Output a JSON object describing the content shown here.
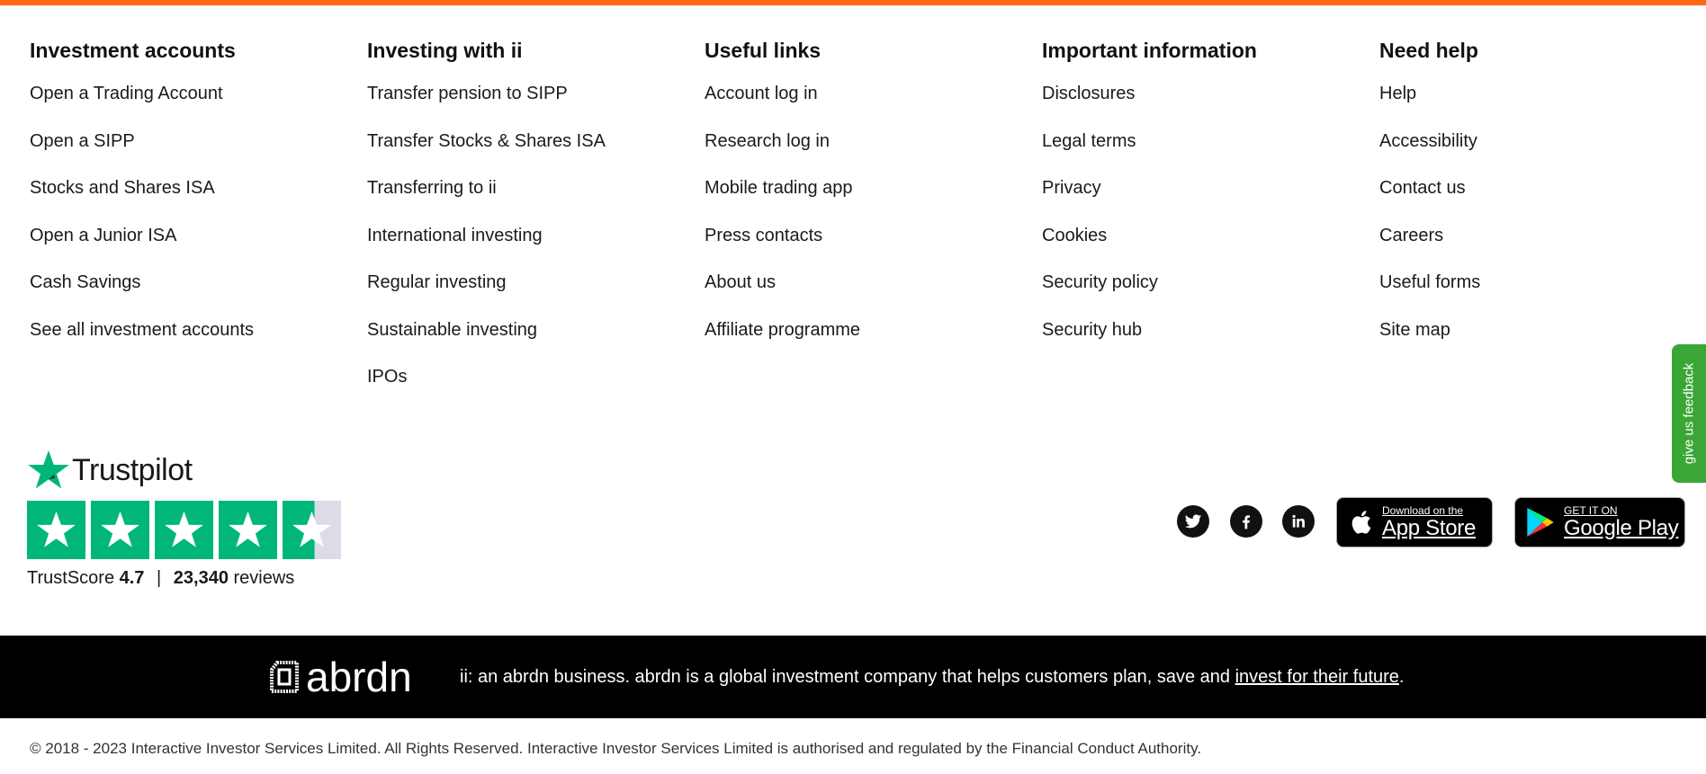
{
  "colors": {
    "accent": "#ff6a13",
    "trustpilot_green": "#00b67a",
    "feedback_green": "#3aa635",
    "band": "#000000"
  },
  "columns": [
    {
      "heading": "Investment accounts",
      "links": [
        "Open a Trading Account",
        "Open a SIPP",
        "Stocks and Shares ISA",
        "Open a Junior ISA",
        "Cash Savings",
        "See all investment accounts"
      ]
    },
    {
      "heading": "Investing with ii",
      "links": [
        "Transfer pension to SIPP",
        "Transfer Stocks & Shares ISA",
        "Transferring to ii",
        "International investing",
        "Regular investing",
        "Sustainable investing",
        "IPOs"
      ]
    },
    {
      "heading": "Useful links",
      "links": [
        "Account log in",
        "Research log in",
        "Mobile trading app",
        "Press contacts",
        "About us",
        "Affiliate programme"
      ]
    },
    {
      "heading": "Important information",
      "links": [
        "Disclosures",
        "Legal terms",
        "Privacy",
        "Cookies",
        "Security policy",
        "Security hub"
      ]
    },
    {
      "heading": "Need help",
      "links": [
        "Help",
        "Accessibility",
        "Contact us",
        "Careers",
        "Useful forms",
        "Site map"
      ]
    }
  ],
  "trustpilot": {
    "brand": "Trustpilot",
    "score_label": "TrustScore",
    "score": "4.7",
    "separator": "|",
    "reviews_count": "23,340",
    "reviews_label": "reviews",
    "rating_out_of_5": 4.5
  },
  "social": {
    "icons": [
      "twitter-icon",
      "facebook-icon",
      "linkedin-icon"
    ]
  },
  "app_store": {
    "small": "Download on the",
    "big": "App Store"
  },
  "google_play": {
    "small": "GET IT ON",
    "big": "Google Play"
  },
  "feedback": {
    "label": "give us feedback"
  },
  "abrdn": {
    "logo_word": "abrdn",
    "text_before": "ii: an abrdn business. abrdn is a global investment company that helps customers plan, save and ",
    "link_text": "invest for their future",
    "text_after": "."
  },
  "copyright": "© 2018 - 2023 Interactive Investor Services Limited. All Rights Reserved. Interactive Investor Services Limited is authorised and regulated by the Financial Conduct Authority."
}
